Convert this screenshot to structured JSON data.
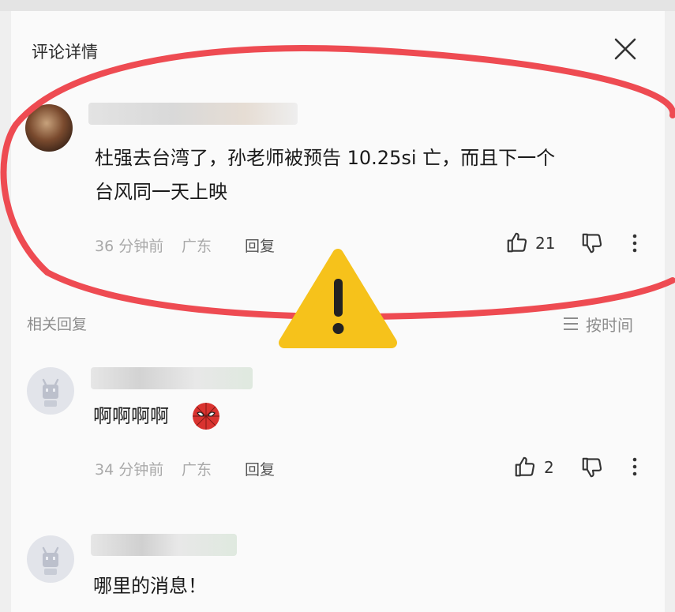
{
  "panel": {
    "title": "评论详情",
    "close_icon": "close-icon"
  },
  "main_comment": {
    "text_line1": "杜强去台湾了，孙老师被预告 10.25si 亡，而且下一个",
    "text_line2": "台风同一天上映",
    "time": "36 分钟前",
    "location": "广东",
    "reply_label": "回复",
    "like_count": "21"
  },
  "replies_section": {
    "label": "相关回复",
    "sort_label": "按时间"
  },
  "replies": [
    {
      "text": "啊啊啊啊",
      "emoji_icon": "spider-mask-emoji-icon",
      "time": "34 分钟前",
      "location": "广东",
      "reply_label": "回复",
      "like_count": "2"
    },
    {
      "text": "哪里的消息！"
    }
  ],
  "overlay": {
    "annotation_color": "#ee4b52",
    "warning_color": "#f6c21b",
    "warning_icon": "warning-triangle-icon"
  }
}
